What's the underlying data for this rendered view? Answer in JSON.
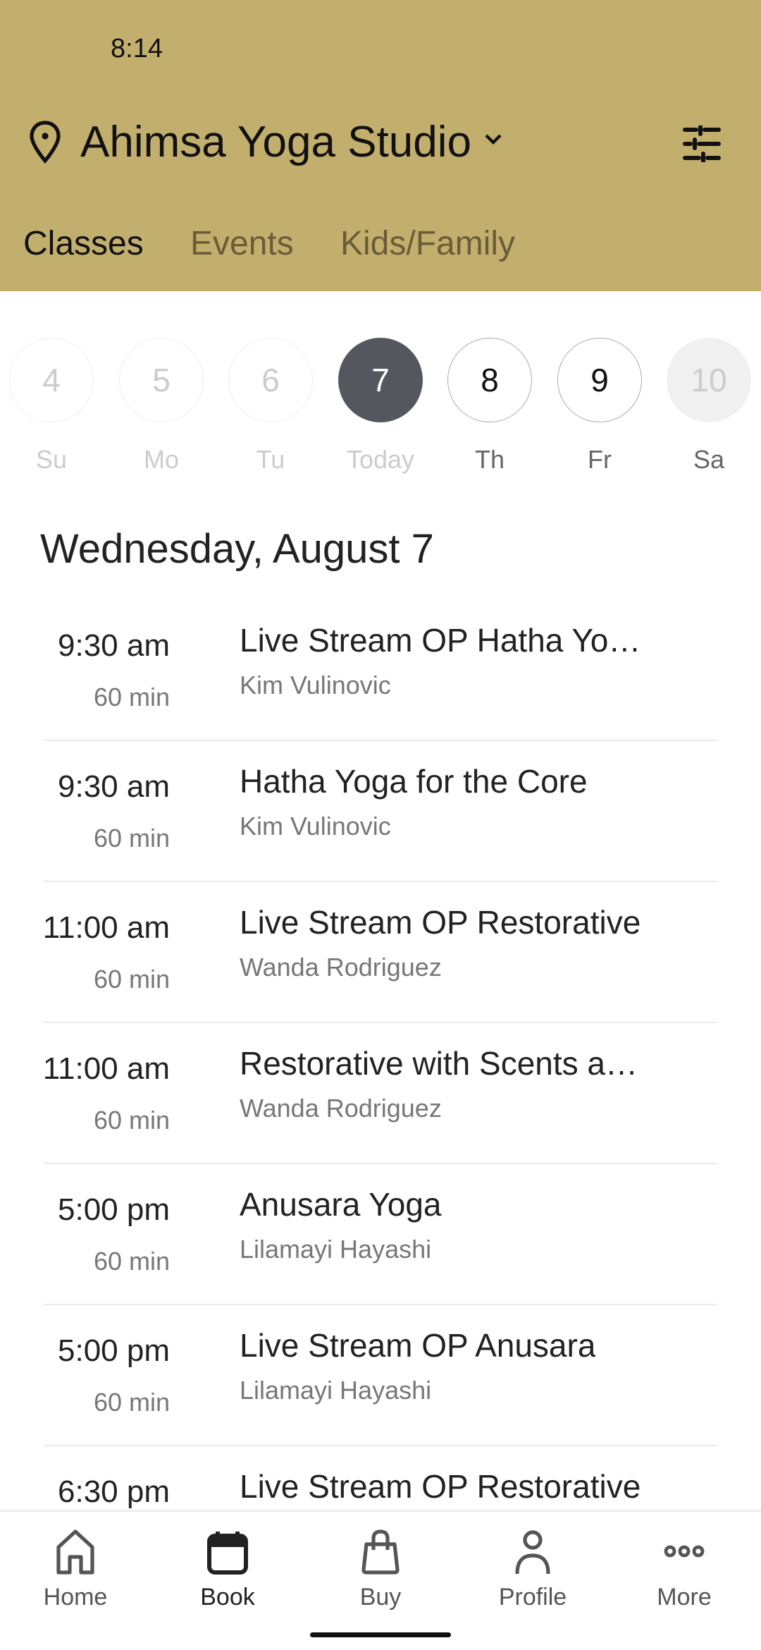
{
  "status_bar": {
    "time": "8:14"
  },
  "header": {
    "studio": "Ahimsa Yoga Studio",
    "bg_color": "#C2AF6E"
  },
  "tabs": [
    {
      "label": "Classes",
      "active": true
    },
    {
      "label": "Events"
    },
    {
      "label": "Kids/Family"
    }
  ],
  "days": [
    {
      "num": "4",
      "label": "Su",
      "state": "past"
    },
    {
      "num": "5",
      "label": "Mo",
      "state": "past"
    },
    {
      "num": "6",
      "label": "Tu",
      "state": "past"
    },
    {
      "num": "7",
      "label": "Today",
      "state": "selected"
    },
    {
      "num": "8",
      "label": "Th",
      "state": "future"
    },
    {
      "num": "9",
      "label": "Fr",
      "state": "future"
    },
    {
      "num": "10",
      "label": "Sa",
      "state": "disabled"
    }
  ],
  "date_heading": "Wednesday, August 7",
  "classes": [
    {
      "time": "9:30 am",
      "duration": "60 min",
      "name": "Live Stream OP Hatha Yo…",
      "instructor": "Kim Vulinovic"
    },
    {
      "time": "9:30 am",
      "duration": "60 min",
      "name": "Hatha Yoga for the Core",
      "instructor": "Kim Vulinovic"
    },
    {
      "time": "11:00 am",
      "duration": "60 min",
      "name": "Live Stream OP Restorative",
      "instructor": "Wanda Rodriguez"
    },
    {
      "time": "11:00 am",
      "duration": "60 min",
      "name": "Restorative with Scents a…",
      "instructor": "Wanda Rodriguez"
    },
    {
      "time": "5:00 pm",
      "duration": "60 min",
      "name": "Anusara Yoga",
      "instructor": "Lilamayi Hayashi"
    },
    {
      "time": "5:00 pm",
      "duration": "60 min",
      "name": "Live Stream OP Anusara",
      "instructor": "Lilamayi Hayashi"
    },
    {
      "time": "6:30 pm",
      "duration": "",
      "name": "Live Stream OP Restorative",
      "instructor": ""
    }
  ],
  "nav": [
    {
      "label": "Home",
      "icon": "home-icon"
    },
    {
      "label": "Book",
      "icon": "calendar-icon",
      "active": true
    },
    {
      "label": "Buy",
      "icon": "bag-icon"
    },
    {
      "label": "Profile",
      "icon": "person-icon"
    },
    {
      "label": "More",
      "icon": "more-icon"
    }
  ]
}
